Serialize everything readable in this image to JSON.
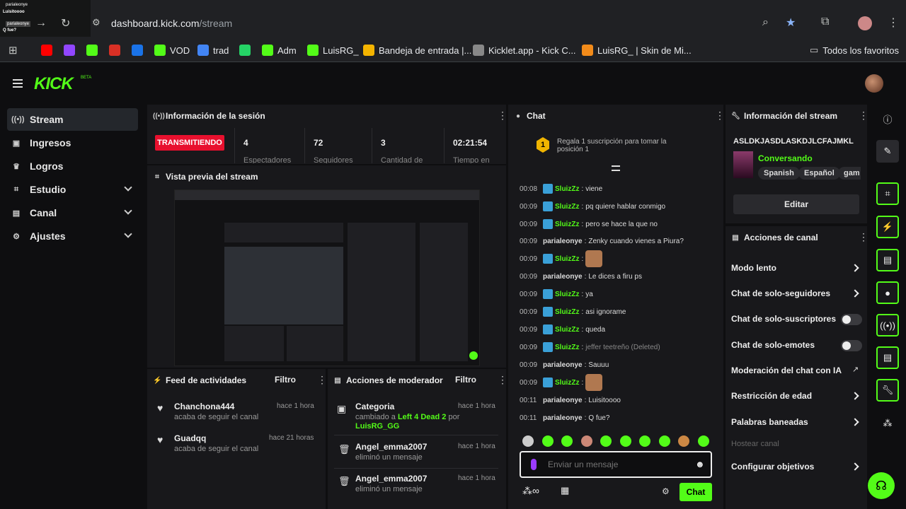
{
  "browser": {
    "url_host": "dashboard.kick.com",
    "url_path": "/stream",
    "bookmarks": [
      {
        "label": "",
        "color": "#ff0000"
      },
      {
        "label": "",
        "color": "#9146ff"
      },
      {
        "label": "",
        "color": "#53fc18"
      },
      {
        "label": "",
        "color": "#d93025"
      },
      {
        "label": "",
        "color": "#1a73e8"
      },
      {
        "label": "VOD",
        "color": "#53fc18"
      },
      {
        "label": "trad",
        "color": "#4285f4"
      },
      {
        "label": "",
        "color": "#25d366"
      },
      {
        "label": "Adm",
        "color": "#53fc18"
      },
      {
        "label": "LuisRG_",
        "color": "#53fc18"
      },
      {
        "label": "Bandeja de entrada |...",
        "color": "#f4b400"
      },
      {
        "label": "Kicklet.app - Kick C...",
        "color": "#888888"
      },
      {
        "label": "LuisRG_ | Skin de Mi...",
        "color": "#f28b1a"
      }
    ],
    "all_favorites": "Todos los favoritos"
  },
  "overlay": {
    "line1": "parialeonye",
    "line2": "Luisitoooo",
    "line3": "parialeonye",
    "line4": "Q fue?"
  },
  "app": {
    "logo": "KICK",
    "logo_beta": "BETA"
  },
  "sidebar": {
    "items": [
      {
        "label": "Stream",
        "icon": "broadcast-icon"
      },
      {
        "label": "Ingresos",
        "icon": "money-icon"
      },
      {
        "label": "Logros",
        "icon": "trophy-icon"
      },
      {
        "label": "Estudio",
        "icon": "studio-icon"
      },
      {
        "label": "Canal",
        "icon": "channel-icon"
      },
      {
        "label": "Ajustes",
        "icon": "gear-icon"
      }
    ]
  },
  "session": {
    "title": "Información de la sesión",
    "status": "TRANSMITIENDO",
    "stats": [
      {
        "value": "4",
        "label": "Espectadores"
      },
      {
        "value": "72",
        "label": "Seguidores"
      },
      {
        "value": "3",
        "label": "Cantidad de"
      },
      {
        "value": "02:21:54",
        "label": "Tiempo en"
      }
    ]
  },
  "preview": {
    "title": "Vista previa del stream"
  },
  "activity": {
    "title": "Feed de actividades",
    "filter": "Filtro",
    "items": [
      {
        "name": "Chanchona444",
        "sub": "acaba de seguir el canal",
        "time": "hace 1 hora"
      },
      {
        "name": "Guadqq",
        "sub": "acaba de seguir el canal",
        "time": "hace 21 horas"
      }
    ]
  },
  "moderator": {
    "title": "Acciones de moderador",
    "filter": "Filtro",
    "items": [
      {
        "name": "Categoria",
        "sub1": "cambiado a",
        "game": "Left 4 Dead 2",
        "sub2": "por",
        "by": "LuisRG_GG",
        "time": "hace 1 hora"
      },
      {
        "name": "Angel_emma2007",
        "sub": "eliminó un mensaje",
        "time": "hace 1 hora"
      },
      {
        "name": "Angel_emma2007",
        "sub": "eliminó un mensaje",
        "time": "hace 1 hora"
      }
    ]
  },
  "chat": {
    "title": "Chat",
    "gift_text": "Regala 1 suscripción para tomar la posición 1",
    "gift_rank": "1",
    "messages": [
      {
        "time": "00:08",
        "user": "SluizZz",
        "badge": true,
        "green": true,
        "text": "viene"
      },
      {
        "time": "00:09",
        "user": "SluizZz",
        "badge": true,
        "green": true,
        "text": "pq quiere hablar conmigo"
      },
      {
        "time": "00:09",
        "user": "SluizZz",
        "badge": true,
        "green": true,
        "text": "pero se hace la que no"
      },
      {
        "time": "00:09",
        "user": "parialeonye",
        "badge": false,
        "green": false,
        "text": "Zenky cuando vienes a Piura?"
      },
      {
        "time": "00:09",
        "user": "SluizZz",
        "badge": true,
        "green": true,
        "text": "",
        "emote": true
      },
      {
        "time": "00:09",
        "user": "parialeonye",
        "badge": false,
        "green": false,
        "text": "Le dices a firu ps"
      },
      {
        "time": "00:09",
        "user": "SluizZz",
        "badge": true,
        "green": true,
        "text": "ya"
      },
      {
        "time": "00:09",
        "user": "SluizZz",
        "badge": true,
        "green": true,
        "text": "asi ignorame"
      },
      {
        "time": "00:09",
        "user": "SluizZz",
        "badge": true,
        "green": true,
        "text": "queda"
      },
      {
        "time": "00:09",
        "user": "SluizZz",
        "badge": true,
        "green": true,
        "text": "jeffer teetreño (Deleted)",
        "deleted": true
      },
      {
        "time": "00:09",
        "user": "parialeonye",
        "badge": false,
        "green": false,
        "text": "Sauuu"
      },
      {
        "time": "00:09",
        "user": "SluizZz",
        "badge": true,
        "green": true,
        "text": "",
        "emote": true
      },
      {
        "time": "00:11",
        "user": "parialeonye",
        "badge": false,
        "green": false,
        "text": "Luisitoooo"
      },
      {
        "time": "00:11",
        "user": "parialeonye",
        "badge": false,
        "green": false,
        "text": "Q fue?"
      }
    ],
    "input_placeholder": "Enviar un mensaje",
    "send_label": "Chat"
  },
  "stream_info": {
    "title": "Información del stream",
    "stream_title": "ASLDKJASDLASKDJLCFAJMKL",
    "category": "Conversando",
    "tags": [
      "Spanish",
      "Español",
      "gam"
    ],
    "edit_label": "Editar"
  },
  "channel_actions": {
    "title": "Acciones de canal",
    "rows": [
      {
        "label": "Modo lento",
        "control": "arrow"
      },
      {
        "label": "Chat de solo-seguidores",
        "control": "arrow"
      },
      {
        "label": "Chat de solo-suscriptores",
        "control": "toggle"
      },
      {
        "label": "Chat de solo-emotes",
        "control": "toggle"
      },
      {
        "label": "Moderación del chat con IA",
        "control": "external"
      },
      {
        "label": "Restricción de edad",
        "control": "arrow"
      },
      {
        "label": "Palabras baneadas",
        "control": "arrow"
      },
      {
        "label": "Hostear canal",
        "control": "none",
        "disabled": true
      },
      {
        "label": "Configurar objetivos",
        "control": "arrow"
      }
    ]
  },
  "colors": {
    "brand": "#53fc18",
    "live": "#e8102e"
  }
}
